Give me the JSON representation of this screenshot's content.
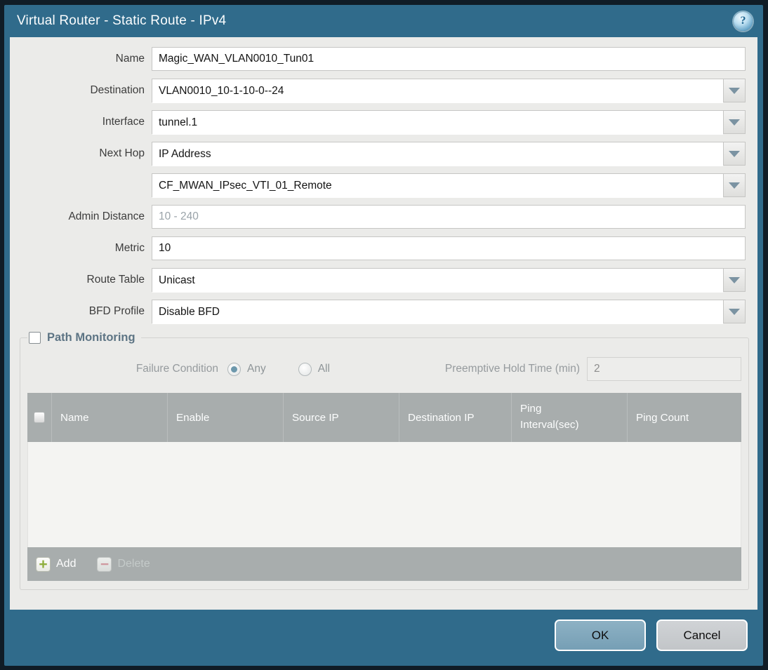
{
  "dialog": {
    "title": "Virtual Router - Static Route - IPv4",
    "help_glyph": "?"
  },
  "form": {
    "name": {
      "label": "Name",
      "value": "Magic_WAN_VLAN0010_Tun01"
    },
    "destination": {
      "label": "Destination",
      "value": "VLAN0010_10-1-10-0--24"
    },
    "interface": {
      "label": "Interface",
      "value": "tunnel.1"
    },
    "next_hop": {
      "label": "Next Hop",
      "value": "IP Address"
    },
    "next_hop_address": {
      "value": "CF_MWAN_IPsec_VTI_01_Remote"
    },
    "admin_distance": {
      "label": "Admin Distance",
      "placeholder": "10 - 240",
      "value": ""
    },
    "metric": {
      "label": "Metric",
      "value": "10"
    },
    "route_table": {
      "label": "Route Table",
      "value": "Unicast"
    },
    "bfd_profile": {
      "label": "BFD Profile",
      "value": "Disable BFD"
    }
  },
  "path_monitoring": {
    "title": "Path Monitoring",
    "enabled": false,
    "failure_condition": {
      "label": "Failure Condition",
      "options": [
        "Any",
        "All"
      ],
      "selected": "Any"
    },
    "preemptive_hold_time": {
      "label": "Preemptive Hold Time (min)",
      "value": "2"
    },
    "table": {
      "columns": [
        "Name",
        "Enable",
        "Source IP",
        "Destination IP",
        "Ping Interval(sec)",
        "Ping Count"
      ],
      "rows": []
    },
    "actions": {
      "add": "Add",
      "delete": "Delete"
    }
  },
  "footer": {
    "ok": "OK",
    "cancel": "Cancel"
  },
  "colors": {
    "frame_teal": "#306b8b",
    "outer_border": "#101c26",
    "content_bg": "#ebebe9",
    "table_header_gray": "#a8adad",
    "add_green": "#8fae3e",
    "delete_red": "#cf99a0",
    "ok_blue": "#7fa7bc"
  }
}
